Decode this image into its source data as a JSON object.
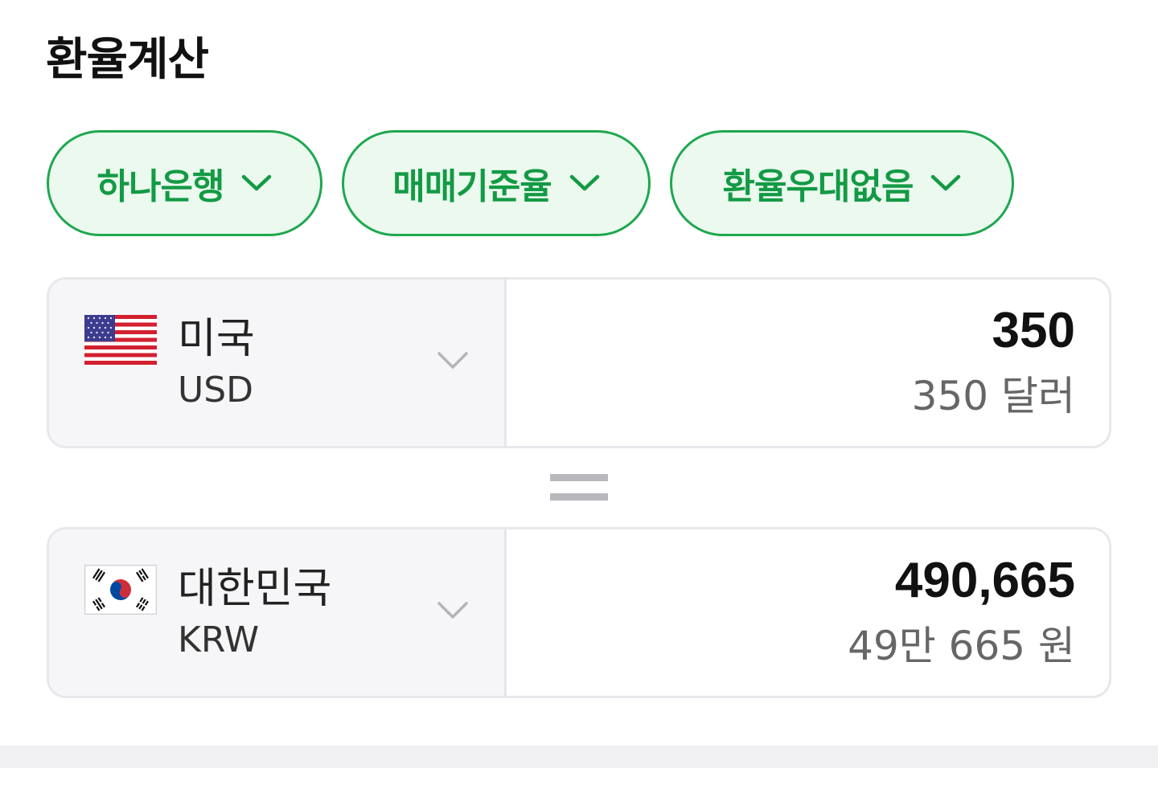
{
  "title": "환율계산",
  "filters": {
    "bank": "하나은행",
    "rate_type": "매매기준율",
    "discount": "환율우대없음"
  },
  "accent_color": "#1fa750",
  "from": {
    "country": "미국",
    "code": "USD",
    "flag_icon": "us-flag-icon",
    "amount": "350",
    "amount_words": "350 달러"
  },
  "to": {
    "country": "대한민국",
    "code": "KRW",
    "flag_icon": "kr-flag-icon",
    "amount": "490,665",
    "amount_words": "49만 665 원"
  }
}
